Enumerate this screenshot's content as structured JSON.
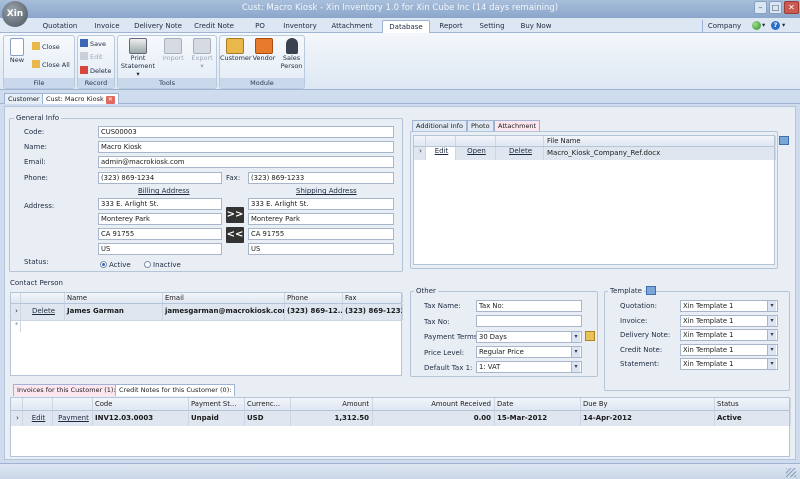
{
  "window": {
    "title": "Cust: Macro Kiosk - Xin Inventory 1.0 for Xin Cube Inc (14 days remaining)",
    "logo": "Xin"
  },
  "ribbon_tabs": [
    "Quotation",
    "Invoice",
    "Delivery Note",
    "Credit Note",
    "PO",
    "Inventory",
    "Attachment",
    "Database",
    "Report",
    "Setting",
    "Buy Now"
  ],
  "company_label": "Company",
  "ribbon": {
    "file": {
      "label": "File",
      "new": "New",
      "close": "Close",
      "close_all": "Close All"
    },
    "record": {
      "label": "Record",
      "save": "Save",
      "edit": "Edit",
      "delete": "Delete"
    },
    "tools": {
      "label": "Tools",
      "print": "Print",
      "statement": "Statement",
      "import": "Import",
      "export": "Export"
    },
    "module": {
      "label": "Module",
      "customer": "Customer",
      "vendor": "Vendor",
      "sales": "Sales",
      "person": "Person"
    }
  },
  "doc_tabs": [
    "Customer",
    "Cust: Macro Kiosk"
  ],
  "general": {
    "title": "General Info",
    "code_label": "Code:",
    "code": "CUS00003",
    "name_label": "Name:",
    "name": "Macro Kiosk",
    "email_label": "Email:",
    "email": "admin@macrokiosk.com",
    "phone_label": "Phone:",
    "phone": "(323) 869-1234",
    "fax_label": "Fax:",
    "fax": "(323) 869-1233",
    "billing_label": "Billing Address",
    "shipping_label": "Shipping Address",
    "address_label": "Address:",
    "billing": [
      "333 E. Arlight St.",
      "Monterey Park",
      "CA 91755",
      "US"
    ],
    "shipping": [
      "333 E. Arlight St.",
      "Monterey Park",
      "CA 91755",
      "US"
    ],
    "copy_right": ">>",
    "copy_left": "<<",
    "status_label": "Status:",
    "active": "Active",
    "inactive": "Inactive"
  },
  "right_tabs": [
    "Additional Info",
    "Photo",
    "Attachment"
  ],
  "attachment": {
    "header": "File Name",
    "edit": "Edit",
    "open": "Open",
    "delete": "Delete",
    "file": "Macro_Kiosk_Company_Ref.docx"
  },
  "contact": {
    "title": "Contact Person",
    "headers": [
      "Name",
      "Email",
      "Phone",
      "Fax"
    ],
    "row": {
      "delete": "Delete",
      "name": "James Garman",
      "email": "jamesgarman@macrokiosk.com",
      "phone": "(323) 869-12...",
      "fax": "(323) 869-1233"
    }
  },
  "other": {
    "title": "Other",
    "tax_name_label": "Tax Name:",
    "tax_name": "Tax No:",
    "tax_no_label": "Tax No:",
    "tax_no": "",
    "terms_label": "Payment Terms:",
    "terms": "30 Days",
    "price_label": "Price Level:",
    "price": "Regular Price",
    "tax1_label": "Default Tax 1:",
    "tax1": "1: VAT"
  },
  "template": {
    "title": "Template",
    "quotation_label": "Quotation:",
    "quotation": "Xin Template 1",
    "invoice_label": "Invoice:",
    "invoice": "Xin Template 1",
    "delivery_label": "Delivery Note:",
    "delivery": "Xin Template 1",
    "credit_label": "Credit Note:",
    "credit": "Xin Template 1",
    "statement_label": "Statement:",
    "statement": "Xin Template 1"
  },
  "bottom_tabs": [
    "Invoices for this Customer (1):",
    "Credit Notes for this Customer (0):"
  ],
  "invoices": {
    "headers": [
      "Code",
      "Payment St...",
      "Currenc...",
      "Amount",
      "Amount Received",
      "Date",
      "Due By",
      "Status"
    ],
    "row": {
      "edit": "Edit",
      "payment": "Payment",
      "code": "INV12.03.0003",
      "pay_status": "Unpaid",
      "currency": "USD",
      "amount": "1,312.50",
      "received": "0.00",
      "date": "15-Mar-2012",
      "due": "14-Apr-2012",
      "status": "Active"
    }
  }
}
